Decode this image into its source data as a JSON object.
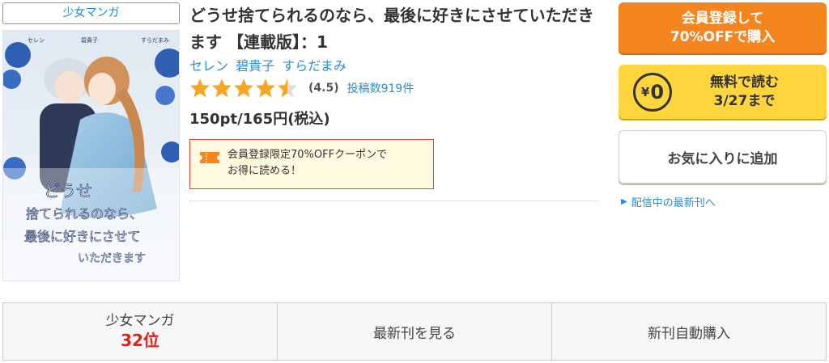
{
  "genre_tag": "少女マンガ",
  "cover": {
    "title_lines": [
      "どうせ",
      "捨てられるのなら、",
      "最後に好きにさせて",
      "いただきます"
    ],
    "credits": [
      "セレン",
      "碧貴子",
      "すらだまみ"
    ]
  },
  "book": {
    "title": "どうせ捨てられるのなら、最後に好きにさせていただきます 【連載版】：1",
    "authors": [
      "セレン",
      "碧貴子",
      "すらだまみ"
    ],
    "rating": 4.5,
    "rating_text": "(4.5)",
    "review_count_text": "投稿数919件",
    "price": "150pt/165円(税込)"
  },
  "coupon": {
    "line1": "会員登録限定70%OFFクーポンで",
    "line2": "お得に読める！"
  },
  "actions": {
    "register_line1": "会員登録して",
    "register_line2": "70%OFFで購入",
    "free_yen": "¥",
    "free_zero": "0",
    "free_line1": "無料で読む",
    "free_line2": "3/27まで",
    "favorite": "お気に入りに追加",
    "latest_link": "配信中の最新刊へ"
  },
  "bottom": {
    "rank_label": "少女マンガ",
    "rank_value": "32位",
    "latest_button": "最新刊を見る",
    "auto_buy_button": "新刊自動購入"
  },
  "colors": {
    "orange": "#f5851f",
    "yellow": "#ffd53d",
    "star": "#f5a623",
    "link": "#2a8fd4",
    "rank": "#e0201a"
  }
}
